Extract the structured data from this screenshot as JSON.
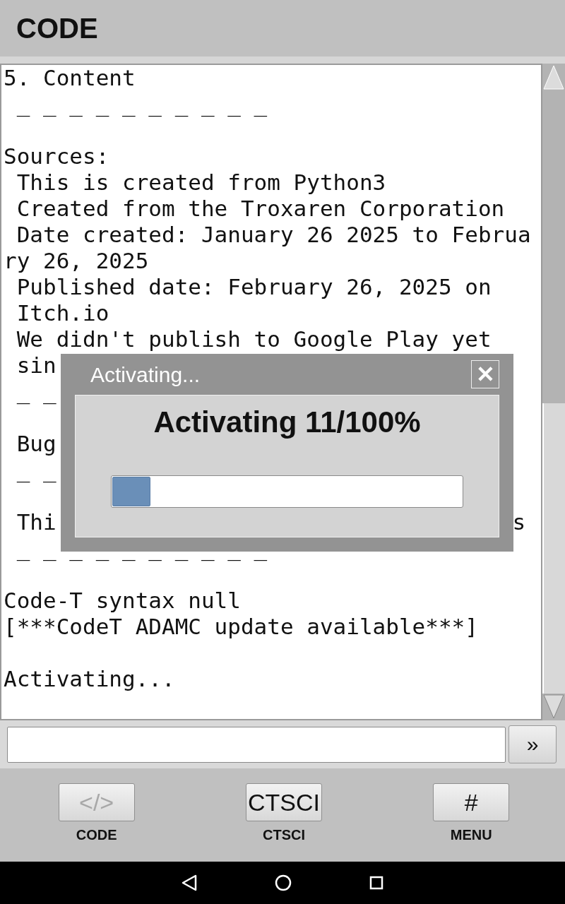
{
  "header": {
    "title": "CODE"
  },
  "console": {
    "lines": [
      {
        "kind": "text",
        "text": "5. Content"
      },
      {
        "kind": "text",
        "text": " _ _ _ _ _ _ _ _ _ _"
      },
      {
        "kind": "blank"
      },
      {
        "kind": "text",
        "text": "Sources:"
      },
      {
        "kind": "text",
        "text": " This is created from Python3"
      },
      {
        "kind": "text",
        "text": " Created from the Troxaren Corporation"
      },
      {
        "kind": "text",
        "text": " Date created: January 26 2025 to Februa"
      },
      {
        "kind": "text",
        "text": "ry 26, 2025"
      },
      {
        "kind": "text",
        "text": " Published date: February 26, 2025 on"
      },
      {
        "kind": "text",
        "text": " Itch.io"
      },
      {
        "kind": "text",
        "text": " We didn't publish to Google Play yet"
      },
      {
        "kind": "text",
        "text": " sin"
      },
      {
        "kind": "text",
        "text": " _ _"
      },
      {
        "kind": "blank"
      },
      {
        "kind": "text",
        "text": " Bug"
      },
      {
        "kind": "text",
        "text": " _ _"
      },
      {
        "kind": "blank"
      },
      {
        "kind": "text",
        "text": " Thi",
        "tail": "s"
      },
      {
        "kind": "text",
        "text": " _ _ _ _ _ _ _ _ _ _"
      },
      {
        "kind": "blank"
      },
      {
        "kind": "text",
        "text": "Code-T syntax null"
      },
      {
        "kind": "text",
        "text": "[***CodeT ADAMC update available***]"
      },
      {
        "kind": "blank"
      },
      {
        "kind": "text",
        "text": "Activating..."
      }
    ]
  },
  "input": {
    "send_button": "»"
  },
  "dialog": {
    "title": "Activating...",
    "close": "✕",
    "heading": "Activating 11/100%",
    "level": 0.11
  },
  "toolbar": [
    {
      "icon": "</>",
      "label": "CODE",
      "disabled": true
    },
    {
      "icon": "CTSCI",
      "label": "CTSCI",
      "disabled": false
    },
    {
      "icon": "#",
      "label": "MENU",
      "disabled": false
    }
  ]
}
